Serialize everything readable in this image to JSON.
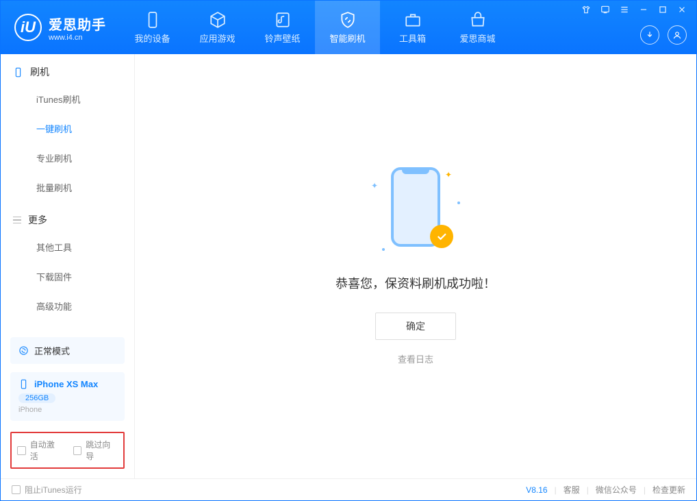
{
  "app": {
    "title": "爱思助手",
    "url": "www.i4.cn",
    "logo_letter": "iU"
  },
  "tabs": [
    {
      "label": "我的设备"
    },
    {
      "label": "应用游戏"
    },
    {
      "label": "铃声壁纸"
    },
    {
      "label": "智能刷机"
    },
    {
      "label": "工具箱"
    },
    {
      "label": "爱思商城"
    }
  ],
  "sidebar": {
    "group1_title": "刷机",
    "items1": [
      "iTunes刷机",
      "一键刷机",
      "专业刷机",
      "批量刷机"
    ],
    "group2_title": "更多",
    "items2": [
      "其他工具",
      "下载固件",
      "高级功能"
    ]
  },
  "mode": {
    "label": "正常模式"
  },
  "device": {
    "name": "iPhone XS Max",
    "capacity": "256GB",
    "type": "iPhone"
  },
  "checks": {
    "auto_activate": "自动激活",
    "skip_guide": "跳过向导"
  },
  "main": {
    "success_msg": "恭喜您，保资料刷机成功啦！",
    "ok": "确定",
    "view_log": "查看日志"
  },
  "status": {
    "block_itunes": "阻止iTunes运行",
    "version": "V8.16",
    "service": "客服",
    "wechat": "微信公众号",
    "check_update": "检查更新"
  }
}
